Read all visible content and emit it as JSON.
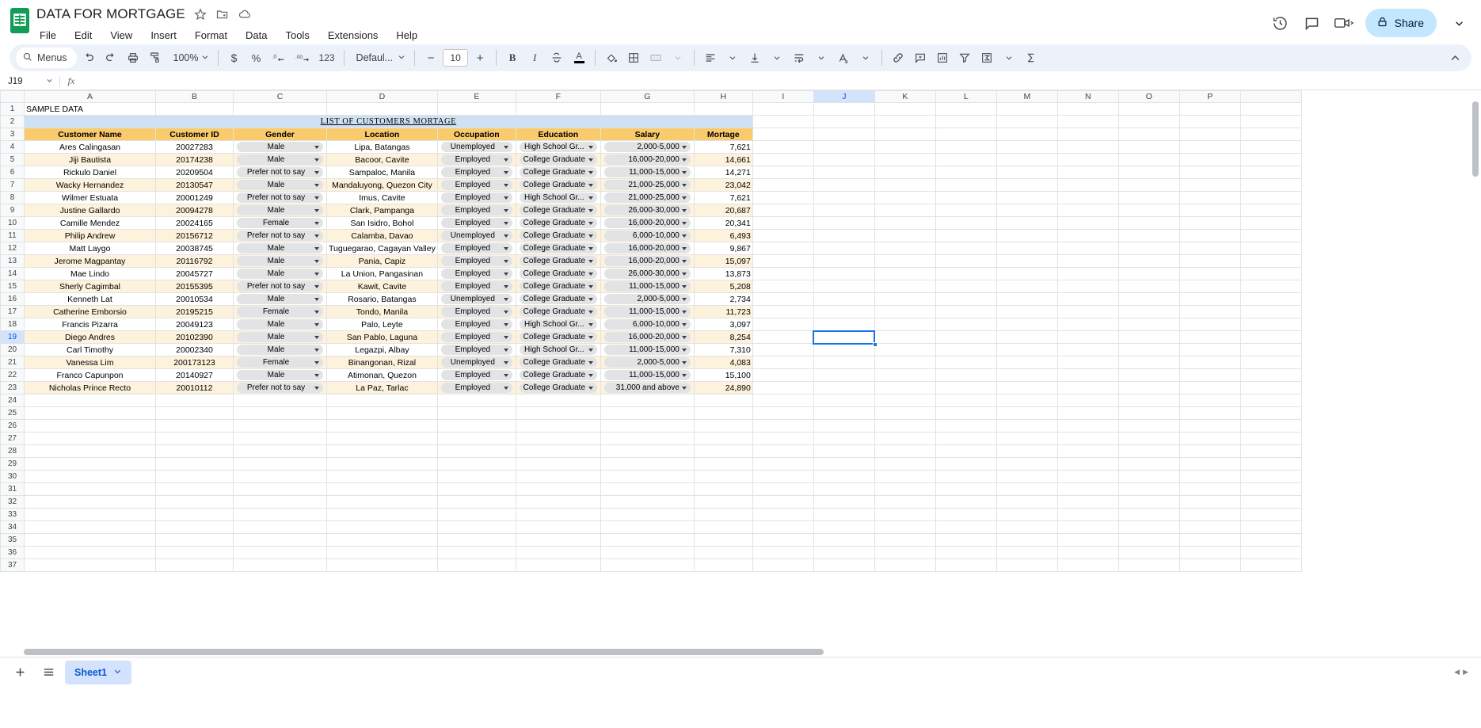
{
  "app": {
    "doc_title": "DATA FOR MORTGAGE",
    "logo_icon": "sheets-logo-icon",
    "title_icons": [
      "star-icon",
      "move-to-folder-icon",
      "cloud-saved-icon"
    ],
    "menus": [
      "File",
      "Edit",
      "View",
      "Insert",
      "Format",
      "Data",
      "Tools",
      "Extensions",
      "Help"
    ],
    "right_icons": [
      "version-history-icon",
      "comment-icon",
      "meet-icon"
    ],
    "share_label": "Share",
    "share_lock_icon": "lock-icon",
    "share_caret_icon": "chevron-down-icon"
  },
  "toolbar": {
    "search_label": "Menus",
    "search_icon": "search-icon",
    "undo_icon": "undo-icon",
    "redo_icon": "redo-icon",
    "print_icon": "print-icon",
    "paint_format_icon": "paint-format-icon",
    "zoom_value": "100%",
    "currency_icon": "currency-dollar-icon",
    "percent_icon": "percent-icon",
    "decimal_decrease_icon": "decimal-decrease-icon",
    "decimal_increase_icon": "decimal-increase-icon",
    "more_formats_label": "123",
    "font_family": "Defaul...",
    "font_size_decrease": "−",
    "font_size": "10",
    "font_size_increase": "+",
    "bold_label": "B",
    "italic_label": "I",
    "strikethrough_icon": "strikethrough-icon",
    "text_color_label": "A",
    "fill_color_icon": "fill-color-icon",
    "borders_icon": "borders-icon",
    "merge_cells_icon": "merge-cells-icon",
    "halign_icon": "horizontal-align-icon",
    "valign_icon": "vertical-align-icon",
    "text_wrap_icon": "text-wrapping-icon",
    "text_rotation_icon": "text-rotation-icon",
    "link_icon": "insert-link-icon",
    "comment_icon": "insert-comment-icon",
    "chart_icon": "insert-chart-icon",
    "filter_icon": "create-filter-icon",
    "functions_icon": "functions-icon",
    "sum_icon": "sigma-icon",
    "collapse_icon": "chevron-up-icon"
  },
  "formula_bar": {
    "name_box": "J19",
    "name_box_caret": "chevron-down-icon",
    "fx_label": "fx",
    "formula_value": ""
  },
  "grid": {
    "column_letters": [
      "A",
      "B",
      "C",
      "D",
      "E",
      "F",
      "G",
      "H",
      "I",
      "J",
      "K",
      "L",
      "M",
      "N",
      "O",
      "P"
    ],
    "selected_column": "J",
    "selected_row": "19",
    "selected_cell": "J19",
    "row_numbers": [
      1,
      2,
      3,
      4,
      5,
      6,
      7,
      8,
      9,
      10,
      11,
      12,
      13,
      14,
      15,
      16,
      17,
      18,
      19,
      20,
      21,
      22,
      23,
      24,
      25,
      26,
      27,
      28,
      29,
      30,
      31,
      32,
      33,
      34,
      35,
      36,
      37
    ],
    "sample_label": "SAMPLE DATA",
    "banner_title": "LIST  OF  CUSTOMERS  MORTAGE",
    "headers": [
      "Customer Name",
      "Customer ID",
      "Gender",
      "Location",
      "Occupation",
      "Education",
      "Salary",
      "Mortage"
    ],
    "header_bg": "#f9cb6d",
    "banner_bg": "#cfe2f3",
    "alt_row_bg": "#fdf2dc",
    "rows": [
      {
        "name": "Ares Calingasan",
        "id": "20027283",
        "gender": "Male",
        "location": "Lipa, Batangas",
        "occupation": "Unemployed",
        "education": "High School Gr...",
        "salary": "2,000-5,000",
        "mortage": "7,621"
      },
      {
        "name": "Jiji Bautista",
        "id": "20174238",
        "gender": "Male",
        "location": "Bacoor, Cavite",
        "occupation": "Employed",
        "education": "College Graduate",
        "salary": "16,000-20,000",
        "mortage": "14,661"
      },
      {
        "name": "Rickulo Daniel",
        "id": "20209504",
        "gender": "Prefer not to say",
        "location": "Sampaloc, Manila",
        "occupation": "Employed",
        "education": "College Graduate",
        "salary": "11,000-15,000",
        "mortage": "14,271"
      },
      {
        "name": "Wacky Hernandez",
        "id": "20130547",
        "gender": "Male",
        "location": "Mandaluyong, Quezon City",
        "occupation": "Employed",
        "education": "College Graduate",
        "salary": "21,000-25,000",
        "mortage": "23,042"
      },
      {
        "name": "Wilmer Estuata",
        "id": "20001249",
        "gender": "Prefer not to say",
        "location": "Imus, Cavite",
        "occupation": "Employed",
        "education": "High School Gr...",
        "salary": "21,000-25,000",
        "mortage": "7,621"
      },
      {
        "name": "Justine Gallardo",
        "id": "20094278",
        "gender": "Male",
        "location": "Clark, Pampanga",
        "occupation": "Employed",
        "education": "College Graduate",
        "salary": "26,000-30,000",
        "mortage": "20,687"
      },
      {
        "name": "Camille Mendez",
        "id": "20024165",
        "gender": "Female",
        "location": "San Isidro, Bohol",
        "occupation": "Employed",
        "education": "College Graduate",
        "salary": "16,000-20,000",
        "mortage": "20,341"
      },
      {
        "name": "Philip Andrew",
        "id": "20156712",
        "gender": "Prefer not to say",
        "location": "Calamba, Davao",
        "occupation": "Unemployed",
        "education": "College Graduate",
        "salary": "6,000-10,000",
        "mortage": "6,493"
      },
      {
        "name": "Matt Laygo",
        "id": "20038745",
        "gender": "Male",
        "location": "Tuguegarao, Cagayan Valley",
        "occupation": "Employed",
        "education": "College Graduate",
        "salary": "16,000-20,000",
        "mortage": "9,867"
      },
      {
        "name": "Jerome Magpantay",
        "id": "20116792",
        "gender": "Male",
        "location": "Pania, Capiz",
        "occupation": "Employed",
        "education": "College Graduate",
        "salary": "16,000-20,000",
        "mortage": "15,097"
      },
      {
        "name": "Mae Lindo",
        "id": "20045727",
        "gender": "Male",
        "location": "La Union, Pangasinan",
        "occupation": "Employed",
        "education": "College Graduate",
        "salary": "26,000-30,000",
        "mortage": "13,873"
      },
      {
        "name": "Sherly Cagimbal",
        "id": "20155395",
        "gender": "Prefer not to say",
        "location": "Kawit, Cavite",
        "occupation": "Employed",
        "education": "College Graduate",
        "salary": "11,000-15,000",
        "mortage": "5,208"
      },
      {
        "name": "Kenneth Lat",
        "id": "20010534",
        "gender": "Male",
        "location": "Rosario, Batangas",
        "occupation": "Unemployed",
        "education": "College Graduate",
        "salary": "2,000-5,000",
        "mortage": "2,734"
      },
      {
        "name": "Catherine Emborsio",
        "id": "20195215",
        "gender": "Female",
        "location": "Tondo, Manila",
        "occupation": "Employed",
        "education": "College Graduate",
        "salary": "11,000-15,000",
        "mortage": "11,723"
      },
      {
        "name": "Francis Pizarra",
        "id": "20049123",
        "gender": "Male",
        "location": "Palo, Leyte",
        "occupation": "Employed",
        "education": "High School Gr...",
        "salary": "6,000-10,000",
        "mortage": "3,097"
      },
      {
        "name": "Diego Andres",
        "id": "20102390",
        "gender": "Male",
        "location": "San Pablo, Laguna",
        "occupation": "Employed",
        "education": "College Graduate",
        "salary": "16,000-20,000",
        "mortage": "8,254"
      },
      {
        "name": "Carl Timothy",
        "id": "20002340",
        "gender": "Male",
        "location": "Legazpi, Albay",
        "occupation": "Employed",
        "education": "High School Gr...",
        "salary": "11,000-15,000",
        "mortage": "7,310"
      },
      {
        "name": "Vanessa Lim",
        "id": "200173123",
        "gender": "Female",
        "location": "Binangonan, Rizal",
        "occupation": "Unemployed",
        "education": "College Graduate",
        "salary": "2,000-5,000",
        "mortage": "4,083"
      },
      {
        "name": "Franco Capunpon",
        "id": "20140927",
        "gender": "Male",
        "location": "Atimonan, Quezon",
        "occupation": "Employed",
        "education": "College Graduate",
        "salary": "11,000-15,000",
        "mortage": "15,100"
      },
      {
        "name": "Nicholas Prince Recto",
        "id": "20010112",
        "gender": "Prefer not to say",
        "location": "La Paz, Tarlac",
        "occupation": "Employed",
        "education": "College Graduate",
        "salary": "31,000 and above",
        "mortage": "24,890"
      }
    ]
  },
  "sheetbar": {
    "add_sheet_icon": "plus-icon",
    "all_sheets_icon": "hamburger-list-icon",
    "tab_label": "Sheet1",
    "tab_caret_icon": "chevron-down-icon"
  }
}
